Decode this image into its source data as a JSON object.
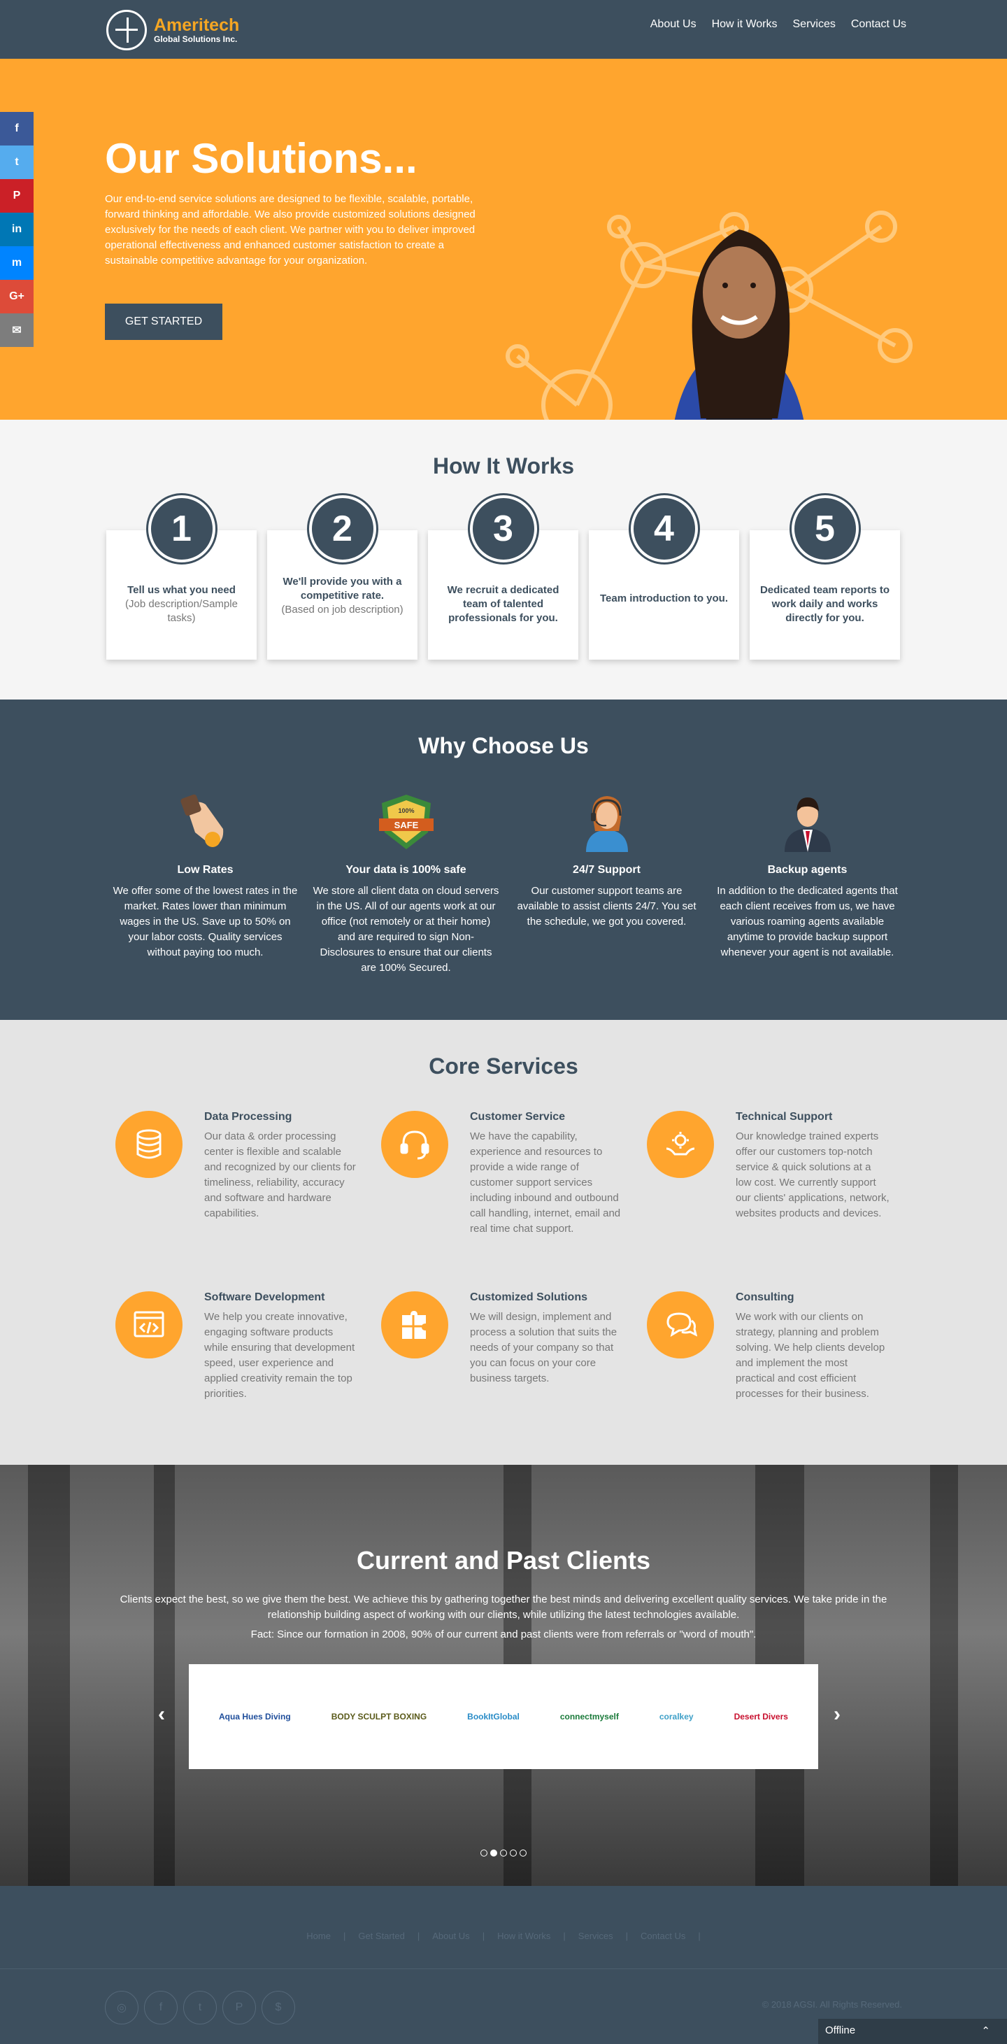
{
  "header": {
    "brand_name": "Ameritech",
    "brand_sub": "Global Solutions Inc.",
    "nav": [
      "About Us",
      "How it Works",
      "Services",
      "Contact Us"
    ]
  },
  "share_bar": [
    {
      "icon": "facebook-icon",
      "glyph": "f",
      "color": "#3b5998"
    },
    {
      "icon": "twitter-icon",
      "glyph": "t",
      "color": "#55acee"
    },
    {
      "icon": "pinterest-icon",
      "glyph": "P",
      "color": "#cb2027"
    },
    {
      "icon": "linkedin-icon",
      "glyph": "in",
      "color": "#0077b5"
    },
    {
      "icon": "messenger-icon",
      "glyph": "m",
      "color": "#0084ff"
    },
    {
      "icon": "google-plus-icon",
      "glyph": "G+",
      "color": "#dd4b39"
    },
    {
      "icon": "email-icon",
      "glyph": "✉",
      "color": "#7d7d7d"
    }
  ],
  "hero": {
    "title": "Our Solutions...",
    "text": "Our end-to-end service solutions are designed to be flexible, scalable, portable, forward thinking and affordable. We also provide customized solutions designed exclusively for the needs of each client. We partner with you to deliver improved operational effectiveness and enhanced customer satisfaction to create a sustainable competitive advantage for your organization.",
    "cta": "GET STARTED"
  },
  "how": {
    "title": "How It Works",
    "steps": [
      {
        "num": "1",
        "title": "Tell us what you need",
        "sub": "(Job description/Sample tasks)"
      },
      {
        "num": "2",
        "title": "We'll provide you with a competitive rate.",
        "sub": "(Based on job description)"
      },
      {
        "num": "3",
        "title": "We recruit a dedicated team of talented professionals for you.",
        "sub": ""
      },
      {
        "num": "4",
        "title": "Team introduction to you.",
        "sub": ""
      },
      {
        "num": "5",
        "title": "Dedicated team reports to work daily and works directly for you.",
        "sub": ""
      }
    ]
  },
  "why": {
    "title": "Why Choose Us",
    "items": [
      {
        "icon": "coin-hand-icon",
        "title": "Low Rates",
        "text": "We offer some of the lowest rates in the market. Rates lower than minimum wages in the US. Save up to 50% on your labor costs. Quality services without paying too much."
      },
      {
        "icon": "safe-badge-icon",
        "title": "Your data is 100% safe",
        "text": "We store all client data on cloud servers in the US. All of our agents work at our office (not remotely or at their home) and are required to sign Non-Disclosures to ensure that our clients are 100% Secured."
      },
      {
        "icon": "support-agent-icon",
        "title": "24/7 Support",
        "text": "Our customer support teams are available to assist clients 24/7. You set the schedule, we got you covered."
      },
      {
        "icon": "backup-agent-icon",
        "title": "Backup agents",
        "text": "In addition to the dedicated agents that each client receives from us, we have various roaming agents available anytime to provide backup support whenever your agent is not available."
      }
    ],
    "badge_top": "100%",
    "badge_text": "SAFE"
  },
  "core": {
    "title": "Core Services",
    "services": [
      {
        "icon": "database-icon",
        "title": "Data Processing",
        "text": "Our data & order processing center is flexible and scalable and recognized by our clients for timeliness, reliability, accuracy and software and hardware capabilities."
      },
      {
        "icon": "headset-icon",
        "title": "Customer Service",
        "text": "We have the capability, experience and resources to provide a wide range of customer support services including inbound and outbound call handling, internet, email and real time chat support."
      },
      {
        "icon": "gear-hands-icon",
        "title": "Technical Support",
        "text": "Our knowledge trained experts offer our customers top-notch service & quick solutions at a low cost. We currently support our clients' applications, network, websites products and devices."
      },
      {
        "icon": "code-window-icon",
        "title": "Software Development",
        "text": "We help you create innovative, engaging software products while ensuring that development speed, user experience and applied creativity remain the top priorities."
      },
      {
        "icon": "puzzle-icon",
        "title": "Customized Solutions",
        "text": "We will design, implement and process a solution that suits the needs of your company so that you can focus on your core business targets."
      },
      {
        "icon": "chat-bubbles-icon",
        "title": "Consulting",
        "text": "We work with our clients on strategy, planning and problem solving. We help clients develop and implement the most practical and cost efficient processes for their business."
      }
    ]
  },
  "clients": {
    "title": "Current and Past Clients",
    "text": "Clients expect the best, so we give them the best. We achieve this by gathering together the best minds and delivering excellent quality services. We take pride in the relationship building aspect of working with our clients, while utilizing the latest technologies available.",
    "fact": "Fact: Since our formation in 2008, 90% of our current and past clients were from referrals or \"word of mouth\".",
    "logos": [
      {
        "text": "Aqua Hues Diving",
        "color": "#1f4e9b"
      },
      {
        "text": "BODY SCULPT BOXING",
        "color": "#5a5a1a"
      },
      {
        "text": "BookItGlobal",
        "color": "#2a8cc7"
      },
      {
        "text": "connectmyself",
        "color": "#1a7a3a"
      },
      {
        "text": "coralkey",
        "color": "#3fa0c8"
      },
      {
        "text": "Desert Divers",
        "color": "#c8102e"
      }
    ],
    "prev": "‹",
    "next": "›",
    "slides": 5,
    "active_slide": 1
  },
  "footer": {
    "links": [
      "Home",
      "Get Started",
      "About Us",
      "How it Works",
      "Services",
      "Contact Us"
    ],
    "social": [
      {
        "icon": "instagram-icon",
        "glyph": "◎"
      },
      {
        "icon": "facebook-icon",
        "glyph": "f"
      },
      {
        "icon": "twitter-icon",
        "glyph": "t"
      },
      {
        "icon": "pinterest-icon",
        "glyph": "P"
      },
      {
        "icon": "brand-icon",
        "glyph": "$"
      }
    ],
    "copyright": "© 2018 AGSI. All Rights Reserved.",
    "chat_status": "Offline",
    "chat_chevron": "⌃"
  },
  "colors": {
    "primary": "#3d4f5e",
    "accent": "#ffa52e"
  }
}
